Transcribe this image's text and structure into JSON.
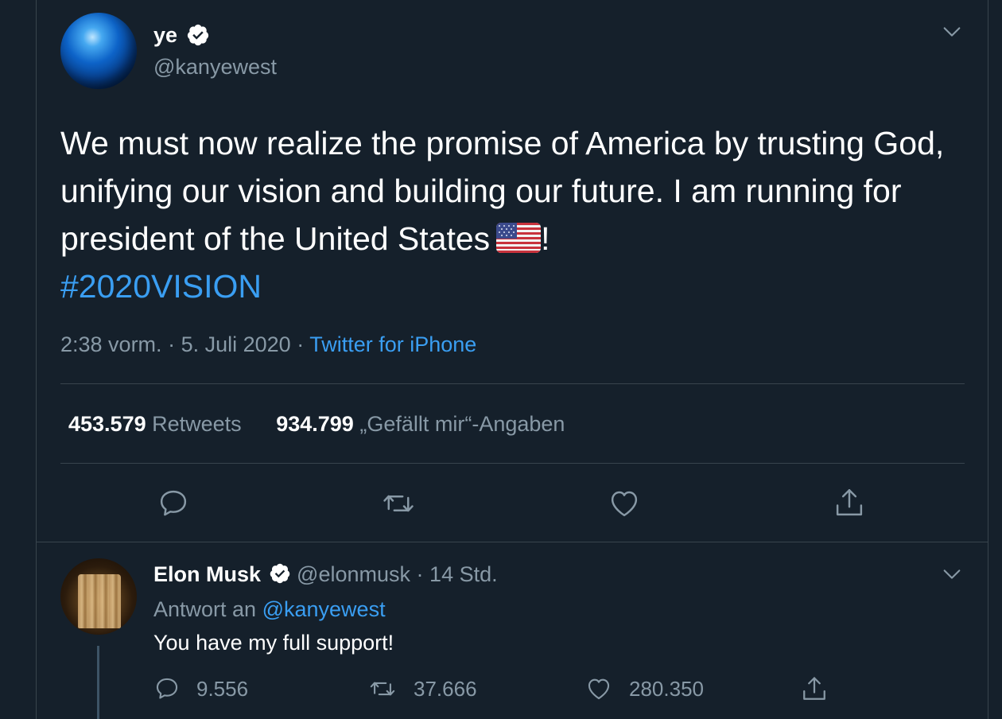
{
  "main_tweet": {
    "display_name": "ye",
    "handle": "@kanyewest",
    "text": "We must now realize the promise of America by trusting God, unifying our vision and building our future. I am running for president of the United States",
    "text_suffix": "!",
    "hashtag": "#2020VISION",
    "time": "2:38 vorm.",
    "separator": "·",
    "date": "5. Juli 2020",
    "source": "Twitter for iPhone",
    "retweets_count": "453.579",
    "retweets_label": "Retweets",
    "likes_count": "934.799",
    "likes_label": "„Gefällt mir“-Angaben"
  },
  "reply": {
    "display_name": "Elon Musk",
    "handle": "@elonmusk",
    "separator": "·",
    "time_ago": "14 Std.",
    "reply_prefix": "Antwort an",
    "reply_to": "@kanyewest",
    "text": "You have my full support!",
    "replies_count": "9.556",
    "retweets_count": "37.666",
    "likes_count": "280.350"
  },
  "colors": {
    "background": "#15202b",
    "divider": "#38444d",
    "secondary_text": "#8899a6",
    "accent": "#3a9ef2"
  },
  "icons": {
    "verified": "verified-badge-icon",
    "more": "chevron-down-icon",
    "reply": "reply-bubble-icon",
    "retweet": "retweet-icon",
    "like": "heart-icon",
    "share": "share-icon"
  }
}
